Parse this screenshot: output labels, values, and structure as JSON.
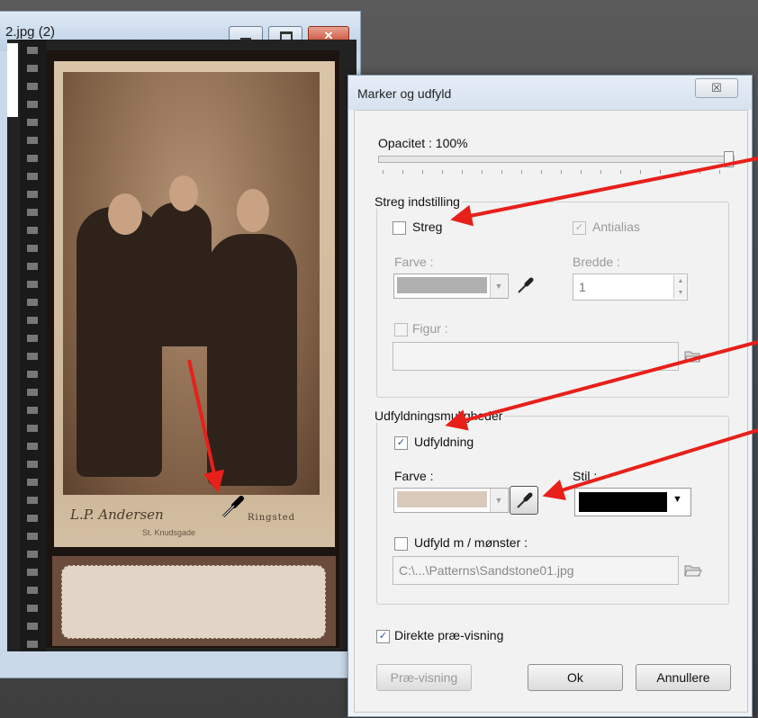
{
  "image_window": {
    "title": "2.jpg (2)",
    "signature": "L.P. Andersen",
    "place": "Ringsted",
    "street": "St. Knudsgade"
  },
  "dialog": {
    "title": "Marker og udfyld",
    "opacity_label": "Opacitet : 100%",
    "opacity_value": 100,
    "stroke_group": {
      "title": "Streg indstilling",
      "stroke_checkbox": {
        "label": "Streg",
        "checked": false
      },
      "antialias_checkbox": {
        "label": "Antialias",
        "checked": true
      },
      "color_label": "Farve :",
      "color": "#b0b0b0",
      "width_label": "Bredde :",
      "width_value": "1",
      "shape_checkbox": {
        "label": "Figur :",
        "checked": false
      },
      "shape_value": ""
    },
    "fill_group": {
      "title": "Udfyldningsmuligheder",
      "fill_checkbox": {
        "label": "Udfyldning",
        "checked": true
      },
      "color_label": "Farve :",
      "color": "#d8c9bb",
      "style_label": "Stil :",
      "style_color": "#000000",
      "pattern_checkbox": {
        "label": "Udfyld m / mønster :",
        "checked": false
      },
      "pattern_path": "C:\\...\\Patterns\\Sandstone01.jpg"
    },
    "preview_checkbox": {
      "label": "Direkte præ-visning",
      "checked": true
    },
    "buttons": {
      "preview": "Præ-visning",
      "ok": "Ok",
      "cancel": "Annullere"
    },
    "close_glyph": "☒"
  },
  "icons": {
    "checkmark": "✓",
    "dropdown": "▼"
  }
}
